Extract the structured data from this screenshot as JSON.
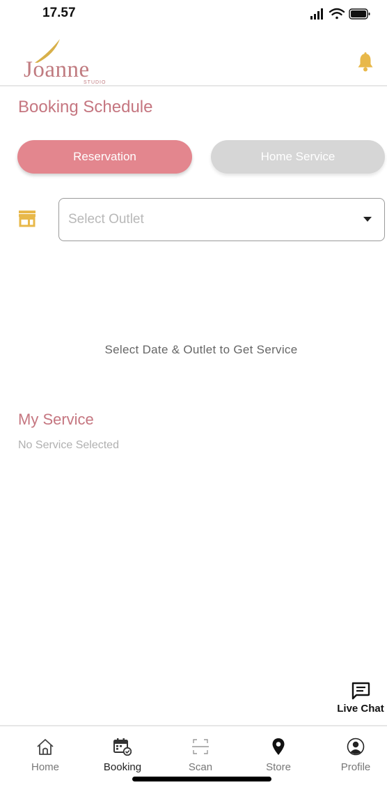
{
  "status_bar": {
    "time": "17.57"
  },
  "header": {
    "logo_text": "Joanne",
    "logo_sub": "STUDIO"
  },
  "page": {
    "title": "Booking Schedule"
  },
  "tabs": {
    "reservation": "Reservation",
    "home_service": "Home Service"
  },
  "outlet": {
    "placeholder": "Select Outlet"
  },
  "hint": "Select Date & Outlet to Get Service",
  "my_service": {
    "title": "My Service",
    "empty": "No Service Selected"
  },
  "chat": {
    "label": "Live Chat"
  },
  "nav": {
    "items": [
      {
        "label": "Home"
      },
      {
        "label": "Booking"
      },
      {
        "label": "Scan"
      },
      {
        "label": "Store"
      },
      {
        "label": "Profile"
      }
    ]
  },
  "colors": {
    "accent": "#c57680",
    "tab_active": "#e3868e",
    "tab_inactive": "#d6d6d6",
    "bell": "#e8b84a"
  }
}
